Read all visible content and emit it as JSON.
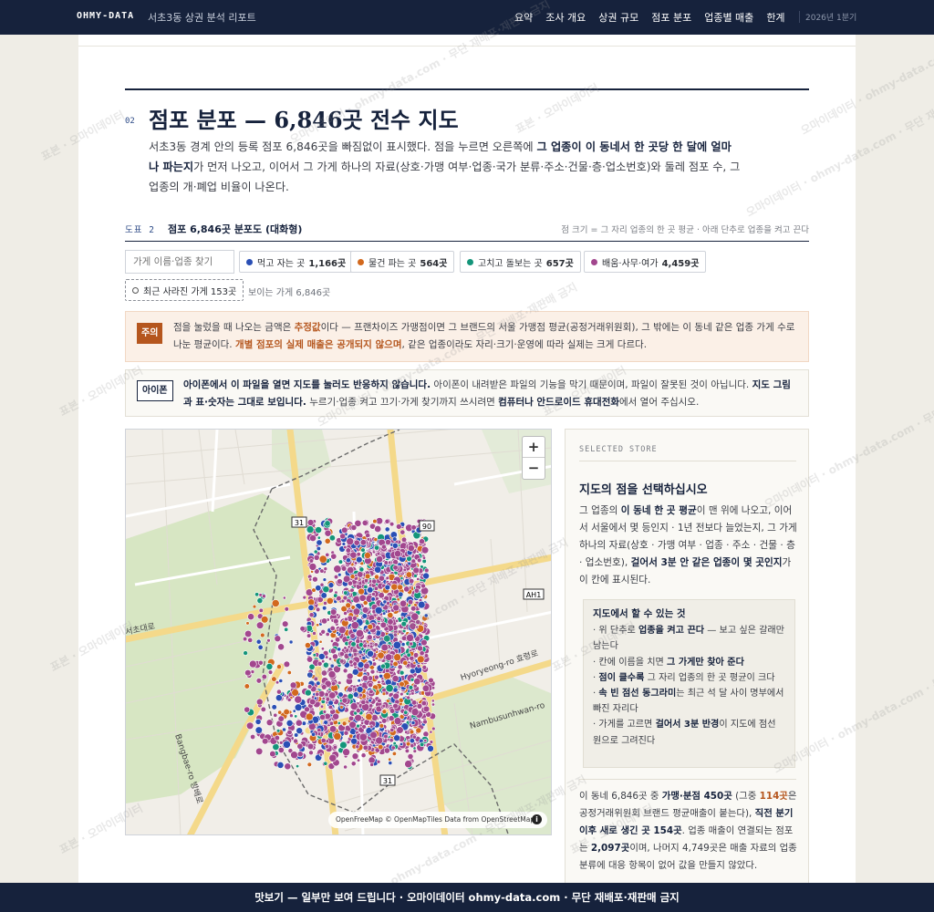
{
  "nav": {
    "brand": "OHMY-DATA",
    "report_title": "서초3동 상권 분석 리포트",
    "links": [
      "요약",
      "조사 개요",
      "상권 규모",
      "점포 분포",
      "업종별 매출",
      "한계"
    ],
    "date": "2026년 1분기"
  },
  "section": {
    "number": "02",
    "title": "점포 분포 — 6,846곳 전수 지도",
    "lead_1": "서초3동 경계 안의 등록 점포 6,846곳을 빠짐없이 표시했다. 점을 누르면 오른쪽에 ",
    "lead_b1": "그 업종이 이 동네서 한 곳당 한 달에 얼마나 파는지",
    "lead_2": "가 먼저 나오고, 이어서 그 가게 하나의 자료(상호·가맹 여부·업종·국가 분류·주소·건물·층·업소번호)와 둘레 점포 수, 그 업종의 개·폐업 비율이 나온다."
  },
  "figure": {
    "tag": "도표 2",
    "title": "점포 6,846곳 분포도 (대화형)",
    "note": "점 크기 = 그 자리 업종의 한 곳 평균 · 아래 단추로 업종을 켜고 끈다"
  },
  "filters": {
    "search_placeholder": "가게 이름·업종 찾기",
    "chips": [
      {
        "label": "먹고 자는 곳",
        "count": "1,166곳",
        "color": "#2a4fb5"
      },
      {
        "label": "물건 파는 곳",
        "count": "564곳",
        "color": "#d2691e"
      },
      {
        "label": "고치고 돌보는 곳",
        "count": "657곳",
        "color": "#14957a"
      },
      {
        "label": "배움·사무·여가",
        "count": "4,459곳",
        "color": "#a2478e"
      }
    ],
    "closed_chip": "최근 사라진 가게 153곳",
    "visible": "보이는 가게 6,846곳"
  },
  "warn": {
    "tag": "주의",
    "t1": "점을 눌렀을 때 나오는 금액은 ",
    "h1": "추정값",
    "t2": "이다 — 프랜차이즈 가맹점이면 그 브랜드의 서울 가맹점 평균(공정거래위원회), 그 밖에는 이 동네 같은 업종 가게 수로 나눈 평균이다. ",
    "h2": "개별 점포의 실제 매출은 공개되지 않으며",
    "t3": ", 같은 업종이라도 자리·크기·운영에 따라 실제는 크게 다르다."
  },
  "ios": {
    "tag": "아이폰",
    "b1": "아이폰에서 이 파일을 열면 지도를 눌러도 반응하지 않습니다.",
    "t1": " 아이폰이 내려받은 파일의 기능을 막기 때문이며, 파일이 잘못된 것이 아닙니다. ",
    "b2": "지도 그림과 표·숫자는 그대로 보입니다.",
    "t2": " 누르기·업종 켜고 끄기·가게 찾기까지 쓰시려면 ",
    "b3": "컴퓨터나 안드로이드 휴대전화",
    "t3": "에서 열어 주십시오."
  },
  "map": {
    "zoom_in": "+",
    "zoom_out": "−",
    "attribution": "OpenFreeMap © OpenMapTiles Data from OpenStreetMap",
    "labels": {
      "seocho": "서초대로",
      "hyoryeong": "Hyoryeong-ro 효령로",
      "nambusunhwan": "Nambusunhwan-ro",
      "bangbae": "Bangbae-ro 방배로",
      "r90": "90",
      "r31": "31",
      "r31b": "31",
      "ah1": "AH1"
    }
  },
  "side": {
    "kicker": "SELECTED STORE",
    "title": "지도의 점을 선택하십시오",
    "d1": "그 업종의 ",
    "db1": "이 동네 한 곳 평균",
    "d2": "이 맨 위에 나오고, 이어서 서울에서 몇 등인지 · 1년 전보다 늘었는지, 그 가게 하나의 자료(상호 · 가맹 여부 · 업종 · 주소 · 건물 · 층 · 업소번호), ",
    "db2": "걸어서 3분 안 같은 업종이 몇 곳인지",
    "d3": "가 이 칸에 표시된다.",
    "tips_title": "지도에서 할 수 있는 것",
    "tips": [
      {
        "pre": "· 위 단추로 ",
        "b": "업종을 켜고 끈다",
        "post": " — 보고 싶은 갈래만 남는다"
      },
      {
        "pre": "· 칸에 이름을 치면 ",
        "b": "그 가게만 찾아 준다",
        "post": ""
      },
      {
        "pre": "· ",
        "b": "점이 클수록",
        "post": " 그 자리 업종의 한 곳 평균이 크다"
      },
      {
        "pre": "· ",
        "b": "속 빈 점선 동그라미",
        "post": "는 최근 석 달 사이 명부에서 빠진 자리다"
      },
      {
        "pre": "· 가게를 고르면 ",
        "b": "걸어서 3분 반경",
        "post": "이 지도에 점선 원으로 그려진다"
      }
    ],
    "f1": "이 동네 6,846곳 중 ",
    "fb1": "가맹·분점 450곳",
    "f2": " (그중 ",
    "fo1": "114곳",
    "f3": "은 공정거래위원회 브랜드 평균매출이 붙는다), ",
    "fb2": "직전 분기 이후 새로 생긴 곳 154곳",
    "f4": ". 업종 매출이 연결되는 점포는 ",
    "fb3": "2,097곳",
    "f5": "이며, 나머지 4,749곳은 매출 자료의 업종 분류에 대응 항목이 없어 값을 만들지 않았다."
  },
  "banner": "맛보기 — 일부만 보여 드립니다 · 오마이데이터 ohmy-data.com · 무단 재배포·재판매 금지",
  "watermark": "오마이데이터 · ohmy-data.com · 무단 재배포·재판매 금지",
  "watermark_short": "표본 · 오마이데이터"
}
